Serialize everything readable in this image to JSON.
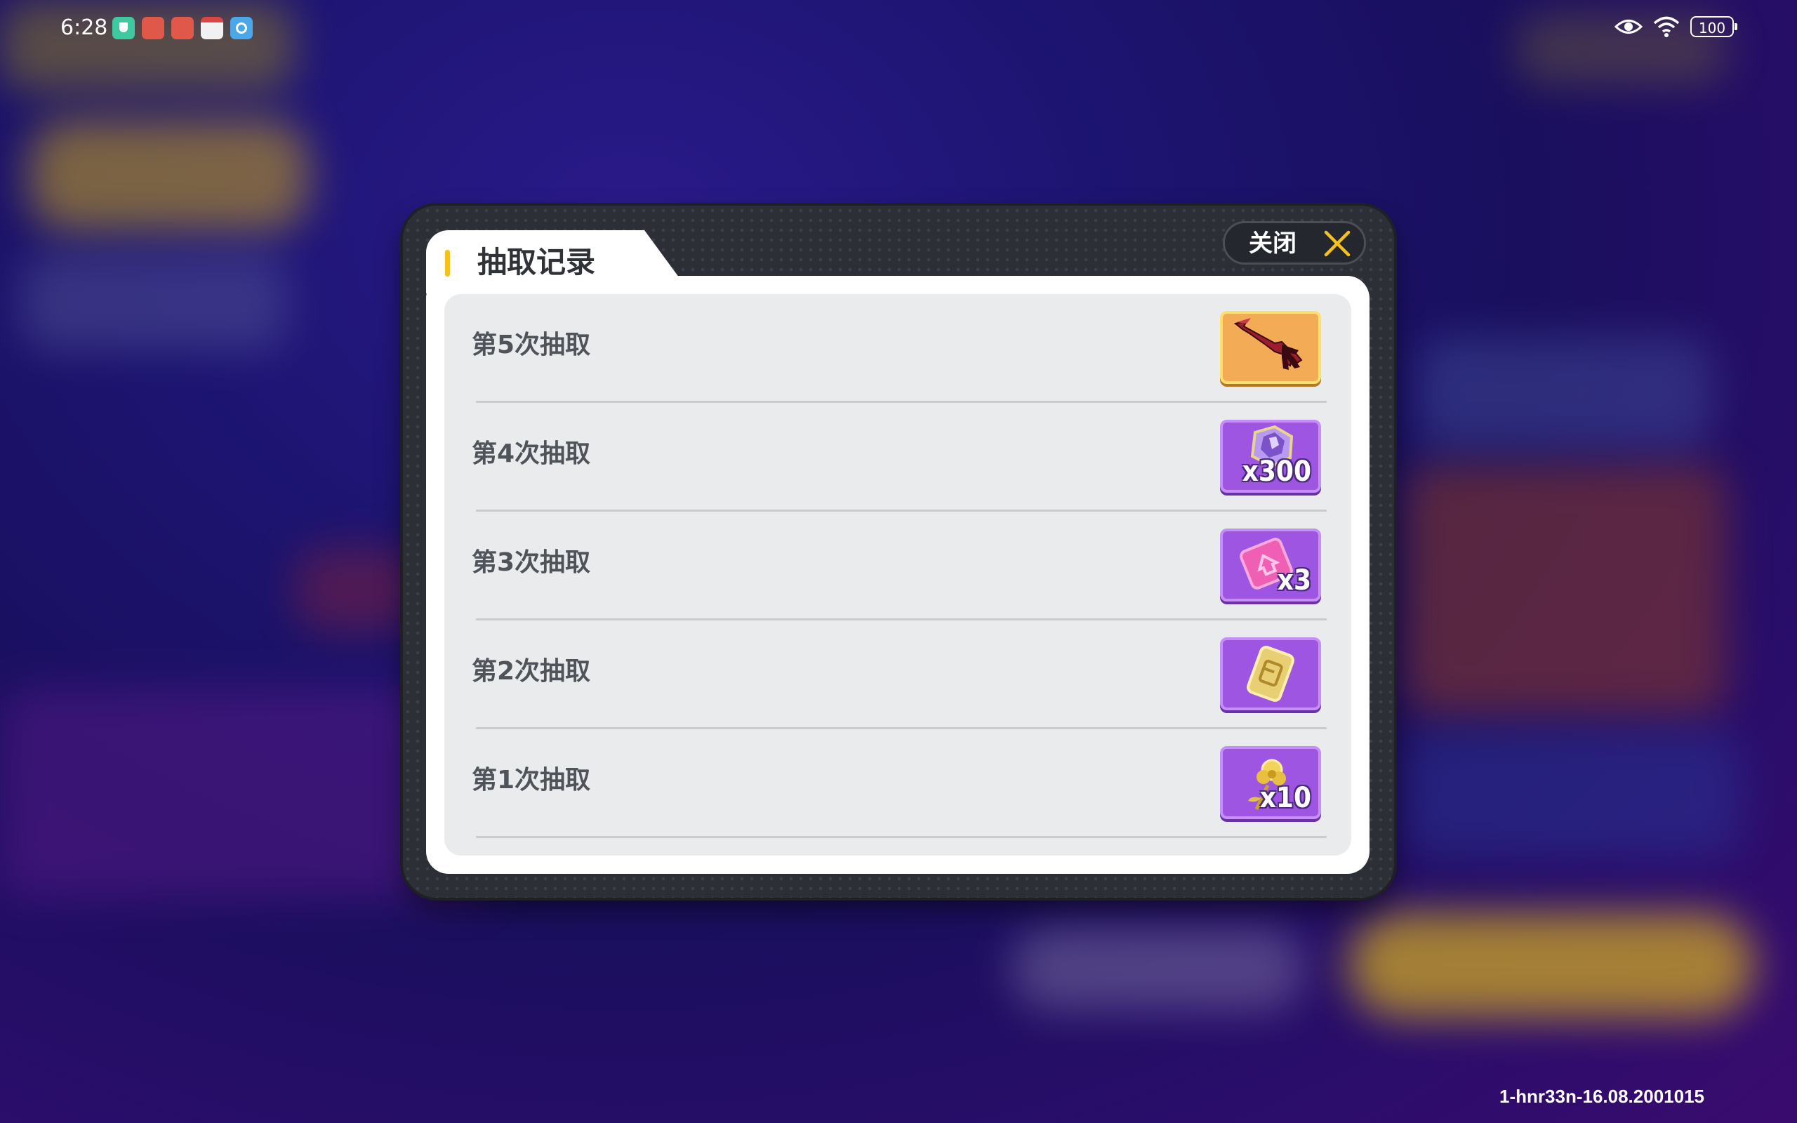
{
  "status_bar": {
    "time": "6:28",
    "battery": "100",
    "notification_icons": [
      "shield-app-icon",
      "red-app-icon",
      "red-app-icon",
      "book-app-icon",
      "compass-app-icon"
    ],
    "right_icons": [
      "eye-icon",
      "wifi-icon",
      "battery-icon"
    ]
  },
  "dialog": {
    "title": "抽取记录",
    "close_label": "关闭",
    "records": [
      {
        "label": "第5次抽取",
        "item_icon": "red-claw-weapon-icon",
        "count": "",
        "tile_color": "#f3ab55"
      },
      {
        "label": "第4次抽取",
        "item_icon": "purple-crystal-icon",
        "count": "x300",
        "tile_color": "#9d55e2"
      },
      {
        "label": "第3次抽取",
        "item_icon": "pink-ticket-icon",
        "count": "x3",
        "tile_color": "#9d55e2"
      },
      {
        "label": "第2次抽取",
        "item_icon": "gold-card-icon",
        "count": "",
        "tile_color": "#9d55e2"
      },
      {
        "label": "第1次抽取",
        "item_icon": "gold-flower-icon",
        "count": "x10",
        "tile_color": "#9d55e2"
      }
    ]
  },
  "footer": {
    "version": "1-hnr33n-16.08.2001015"
  },
  "colors": {
    "accent_yellow": "#f4c21b",
    "dialog_frame": "#2c2f36",
    "list_background": "#eaebed",
    "tile_purple": "#9d55e2",
    "tile_orange": "#f3ab55"
  }
}
